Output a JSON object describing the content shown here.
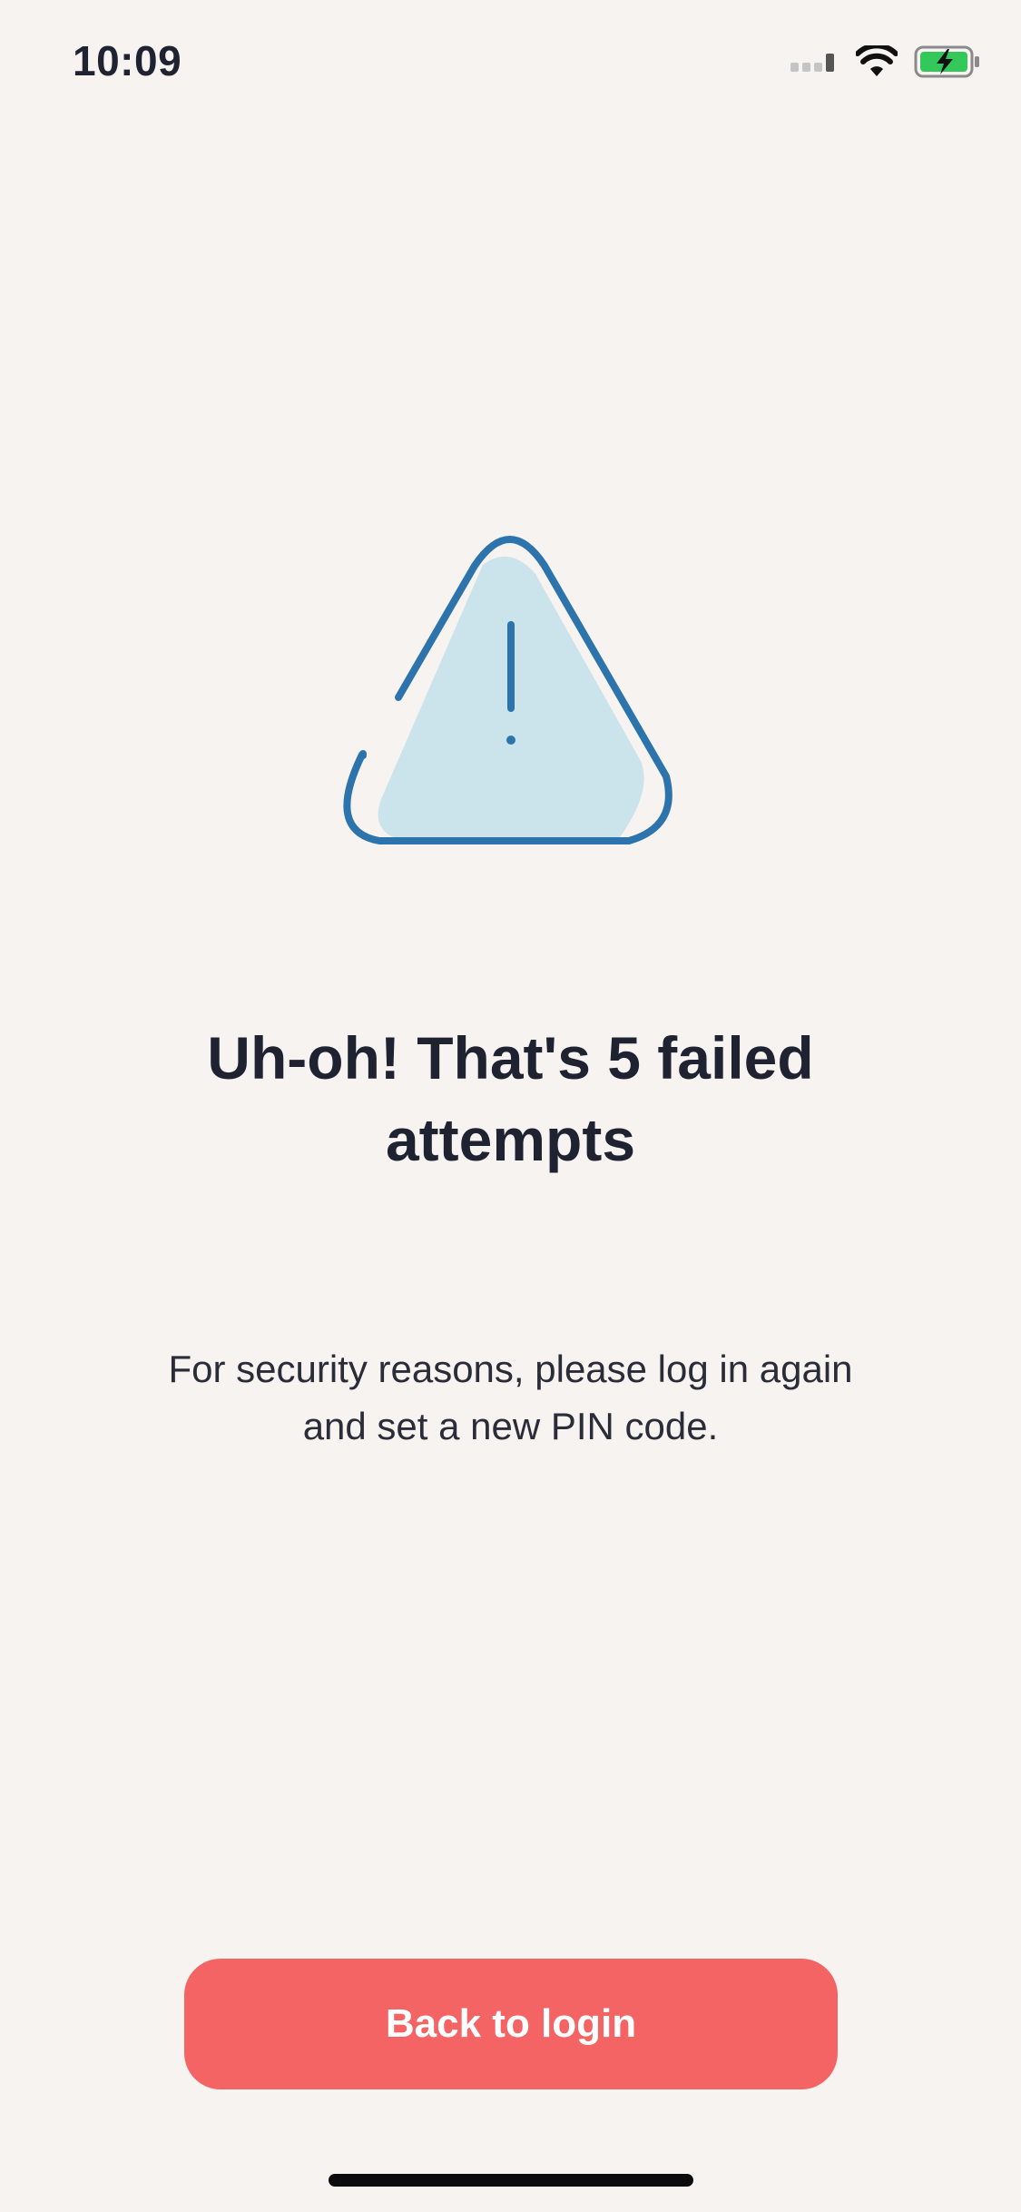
{
  "status_bar": {
    "time": "10:09",
    "icons": [
      "cellular-signal-icon",
      "wifi-icon",
      "battery-charging-icon"
    ],
    "battery_color": "#34c759"
  },
  "illustration": {
    "icon": "warning-triangle-icon",
    "stroke_color": "#2d74ad",
    "fill_color": "#cbe3eb"
  },
  "message": {
    "title": "Uh-oh! That's 5 failed attempts",
    "description": "For security reasons, please log in again and set a new PIN code."
  },
  "actions": {
    "back_to_login_label": "Back to login",
    "button_color": "#f46464"
  }
}
